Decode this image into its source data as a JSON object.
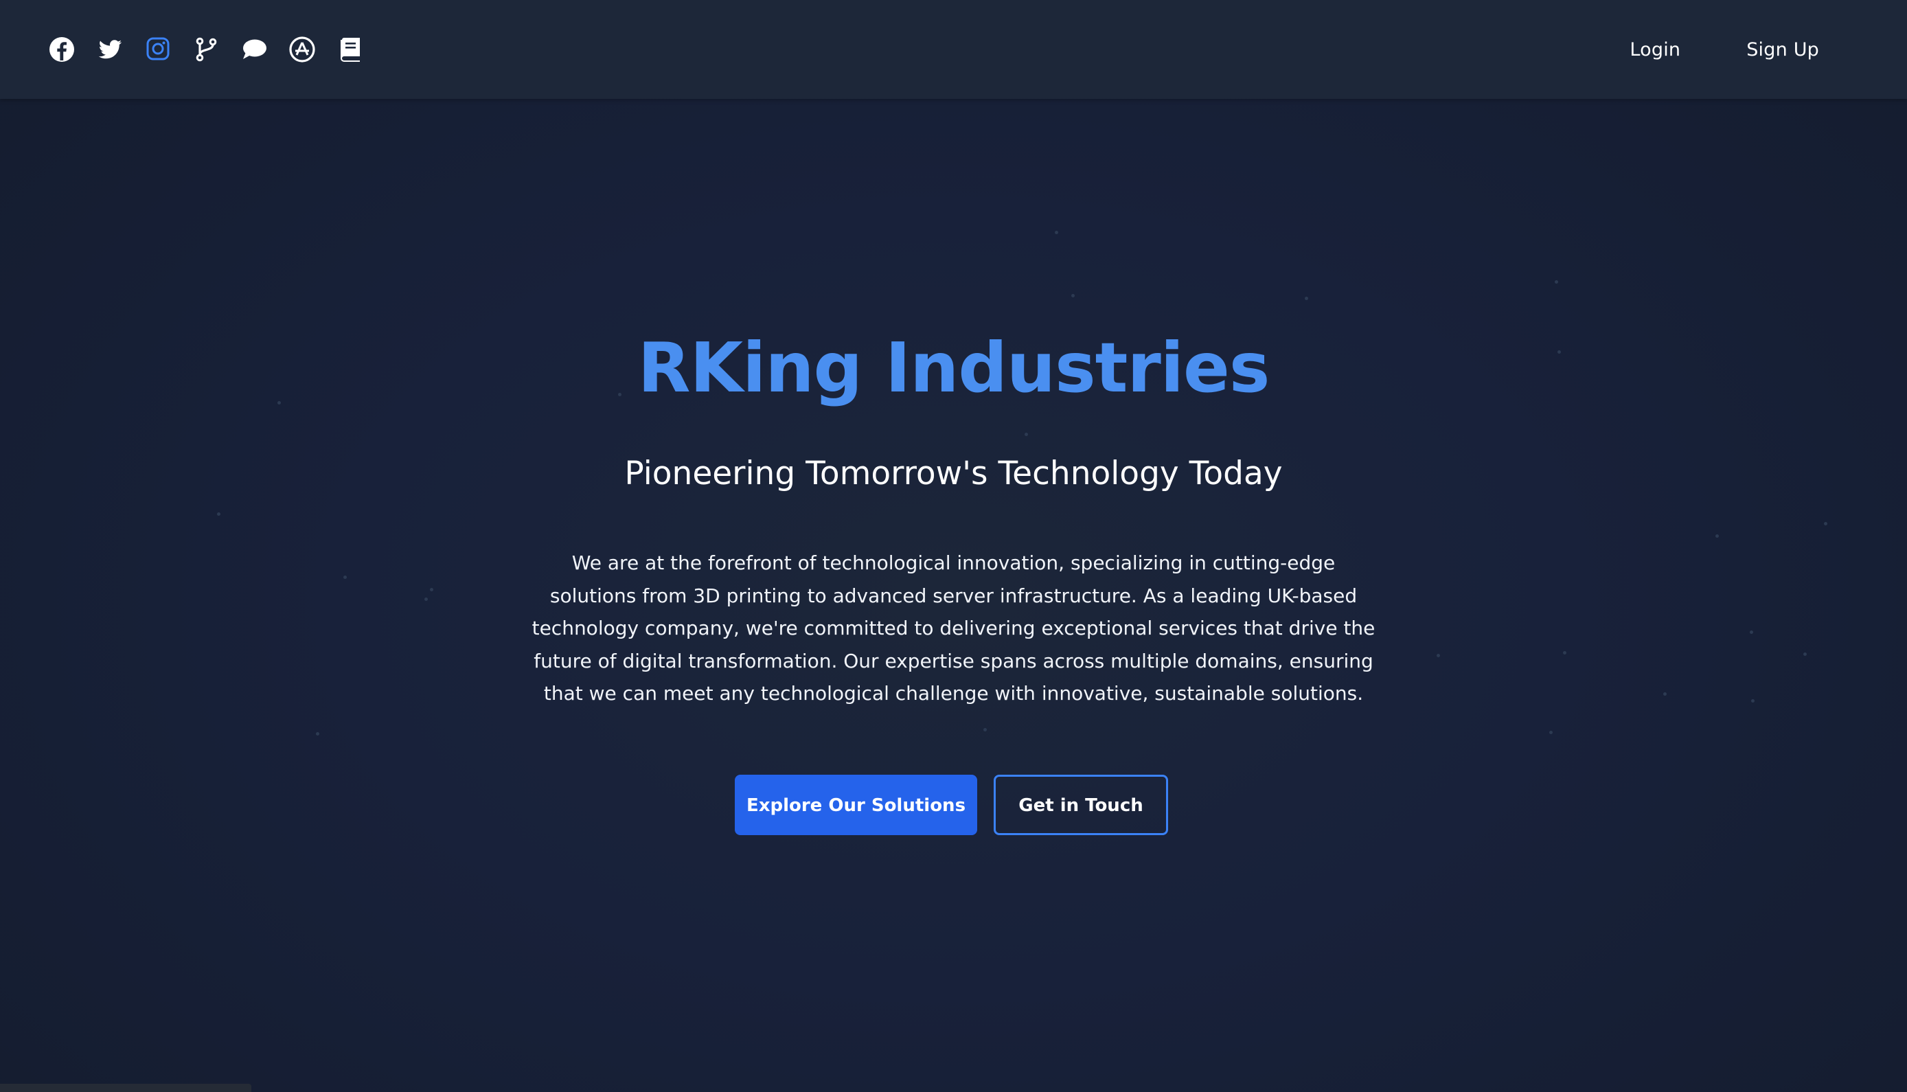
{
  "nav": {
    "social_icons": [
      {
        "name": "facebook-icon",
        "color": "#ffffff"
      },
      {
        "name": "twitter-icon",
        "color": "#ffffff"
      },
      {
        "name": "instagram-icon",
        "color": "#3b82f6"
      },
      {
        "name": "git-branch-icon",
        "color": "#ffffff"
      },
      {
        "name": "chat-bubble-icon",
        "color": "#ffffff"
      },
      {
        "name": "app-store-icon",
        "color": "#ffffff"
      },
      {
        "name": "book-icon",
        "color": "#ffffff"
      }
    ],
    "login_label": "Login",
    "signup_label": "Sign Up"
  },
  "hero": {
    "title": "RKing Industries",
    "subtitle": "Pioneering Tomorrow's Technology Today",
    "description": "We are at the forefront of technological innovation, specializing in cutting-edge solutions from 3D printing to advanced server infrastructure. As a leading UK-based technology company, we're committed to delivering exceptional services that drive the future of digital transformation. Our expertise spans across multiple domains, ensuring that we can meet any technological challenge with innovative, sustainable solutions.",
    "primary_button": "Explore Our Solutions",
    "secondary_button": "Get in Touch"
  },
  "colors": {
    "accent": "#4a8ff0",
    "primary_button": "#2563eb",
    "button_border": "#3b82f6",
    "background": "#172033"
  }
}
